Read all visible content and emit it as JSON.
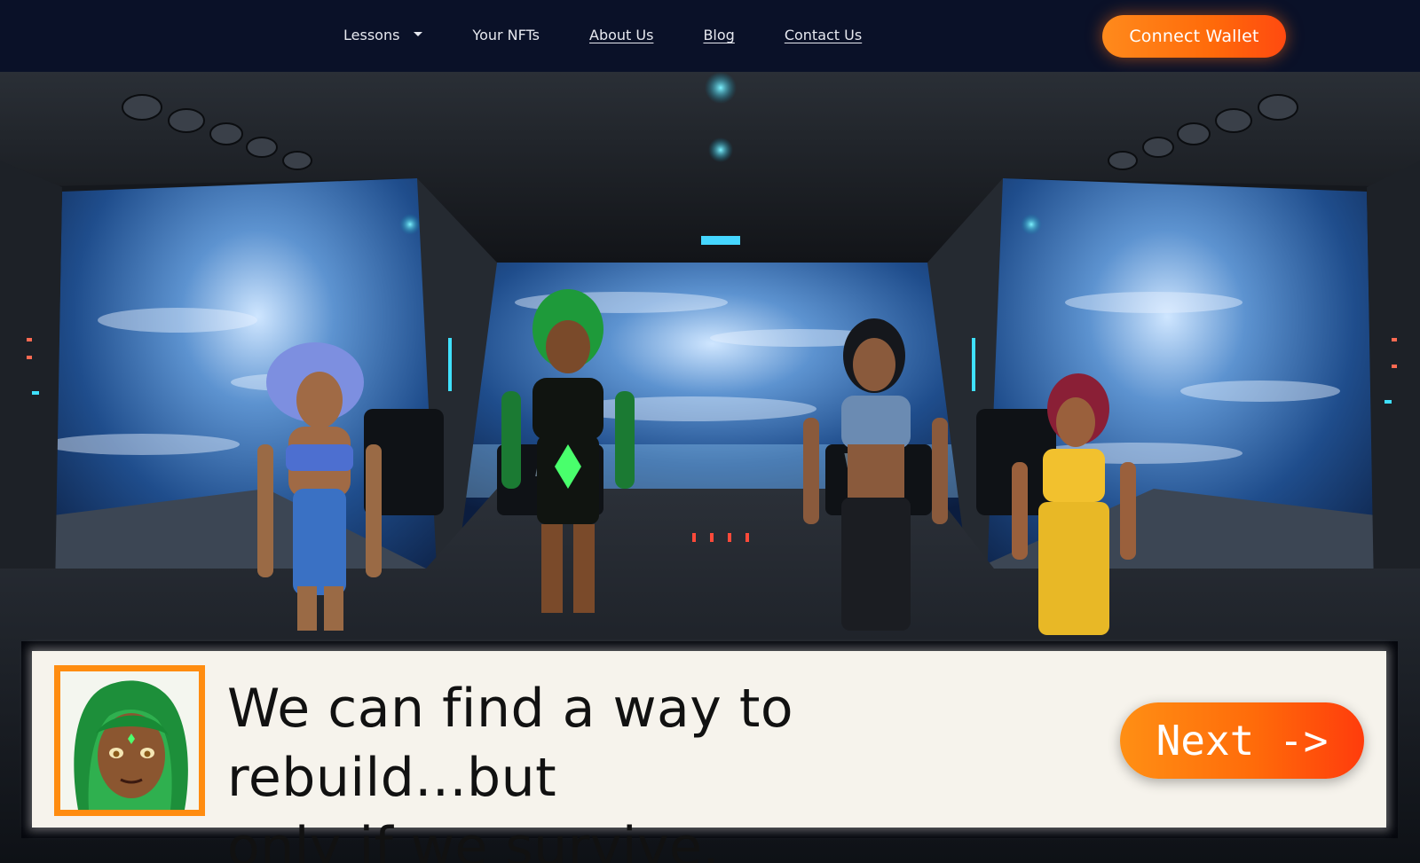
{
  "nav": {
    "items": [
      {
        "label": "Lessons",
        "has_dropdown": true
      },
      {
        "label": "Your NFTs",
        "underlined": false
      },
      {
        "label": "About Us",
        "underlined": true
      },
      {
        "label": "Blog",
        "underlined": true
      },
      {
        "label": "Contact Us",
        "underlined": true
      }
    ],
    "connect_label": "Connect Wallet"
  },
  "dialog": {
    "line1": "We can find a way to rebuild...but",
    "line2": "only if we survive.",
    "next_label": "Next ->"
  },
  "colors": {
    "nav_bg": "#0a1128",
    "accent_orange": "#ff7a12",
    "dialog_bg": "#f6f3ec",
    "portrait_border": "#ff8c10"
  }
}
